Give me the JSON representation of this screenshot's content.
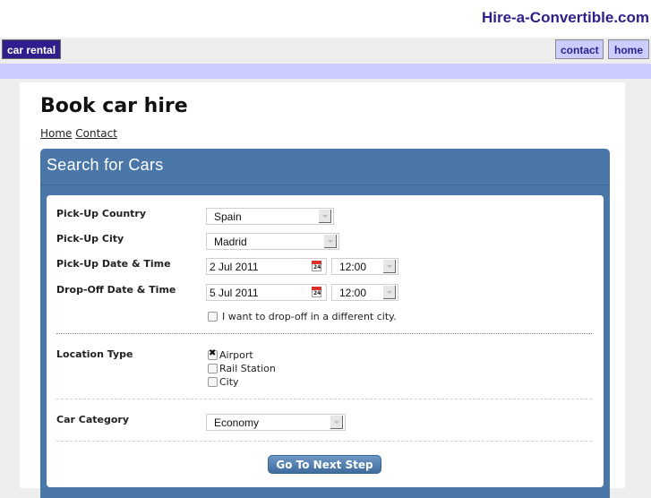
{
  "header": {
    "site_title": "Hire-a-Convertible.com"
  },
  "nav": {
    "left": "car rental",
    "contact": "contact",
    "home": "home"
  },
  "page": {
    "title": "Book car hire",
    "breadcrumb": [
      "Home",
      "Contact"
    ]
  },
  "panel": {
    "title": "Search for Cars"
  },
  "form": {
    "pickup_country": {
      "label": "Pick-Up Country",
      "value": "Spain"
    },
    "pickup_city": {
      "label": "Pick-Up City",
      "value": "Madrid"
    },
    "pickup_datetime": {
      "label": "Pick-Up Date & Time",
      "date": "2 Jul 2011",
      "time": "12:00"
    },
    "dropoff_datetime": {
      "label": "Drop-Off Date & Time",
      "date": "5 Jul 2011",
      "time": "12:00"
    },
    "calendar_icon_text": "24",
    "different_city": {
      "label": "I want to drop-off in a different city.",
      "checked": false
    },
    "location_type": {
      "label": "Location Type",
      "options": [
        {
          "label": "Airport",
          "checked": true
        },
        {
          "label": "Rail Station",
          "checked": false
        },
        {
          "label": "City",
          "checked": false
        }
      ]
    },
    "car_category": {
      "label": "Car Category",
      "value": "Economy"
    },
    "submit": "Go To Next Step"
  }
}
